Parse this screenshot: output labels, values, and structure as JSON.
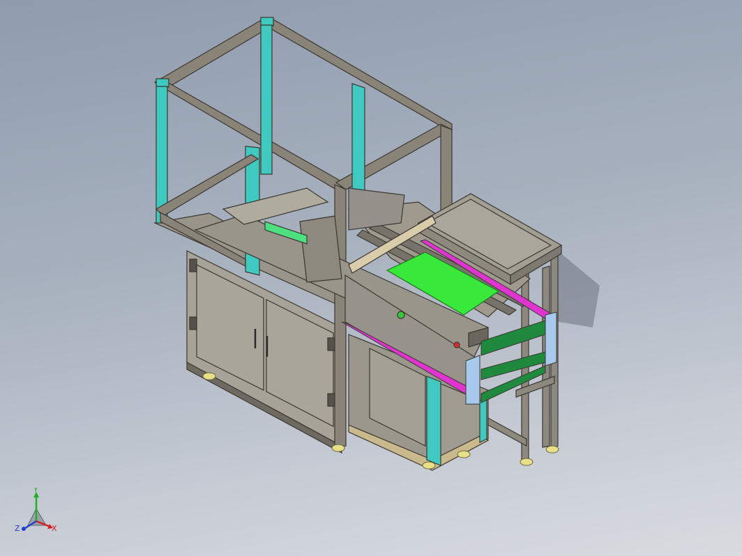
{
  "view": {
    "name": "isometric-cad-viewport",
    "colors": {
      "frame": "#8a8478",
      "frame_edge": "#3a3630",
      "panel": "#a8a398",
      "panel_dark": "#8e897f",
      "cyan": "#3fc9c0",
      "magenta": "#e034d0",
      "green_plate": "#38e83a",
      "dark_green": "#1f8a3e",
      "light_blue": "#a8c8ec",
      "feet": "#e8e088"
    }
  },
  "triad": {
    "x_label": "X",
    "y_label": "Y",
    "z_label": "Z",
    "x_color": "#d62020",
    "y_color": "#20b020",
    "z_color": "#2040d0"
  }
}
